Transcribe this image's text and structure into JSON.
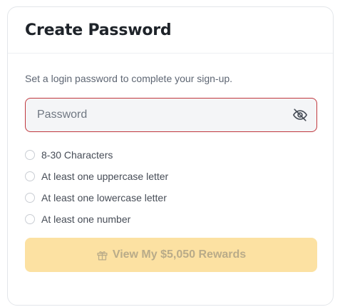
{
  "header": {
    "title": "Create Password"
  },
  "form": {
    "subtitle": "Set a login password to complete your sign-up.",
    "password_placeholder": "Password",
    "password_value": "",
    "toggle_icon": "eye-slash-icon",
    "field_border_color": "#c0373d"
  },
  "requirements": [
    {
      "label": "8-30 Characters",
      "met": false
    },
    {
      "label": "At least one uppercase letter",
      "met": false
    },
    {
      "label": "At least one lowercase letter",
      "met": false
    },
    {
      "label": "At least one number",
      "met": false
    }
  ],
  "cta": {
    "label": "View My $5,050 Rewards",
    "icon": "gift-icon",
    "disabled": true,
    "background": "#fce1a2"
  }
}
